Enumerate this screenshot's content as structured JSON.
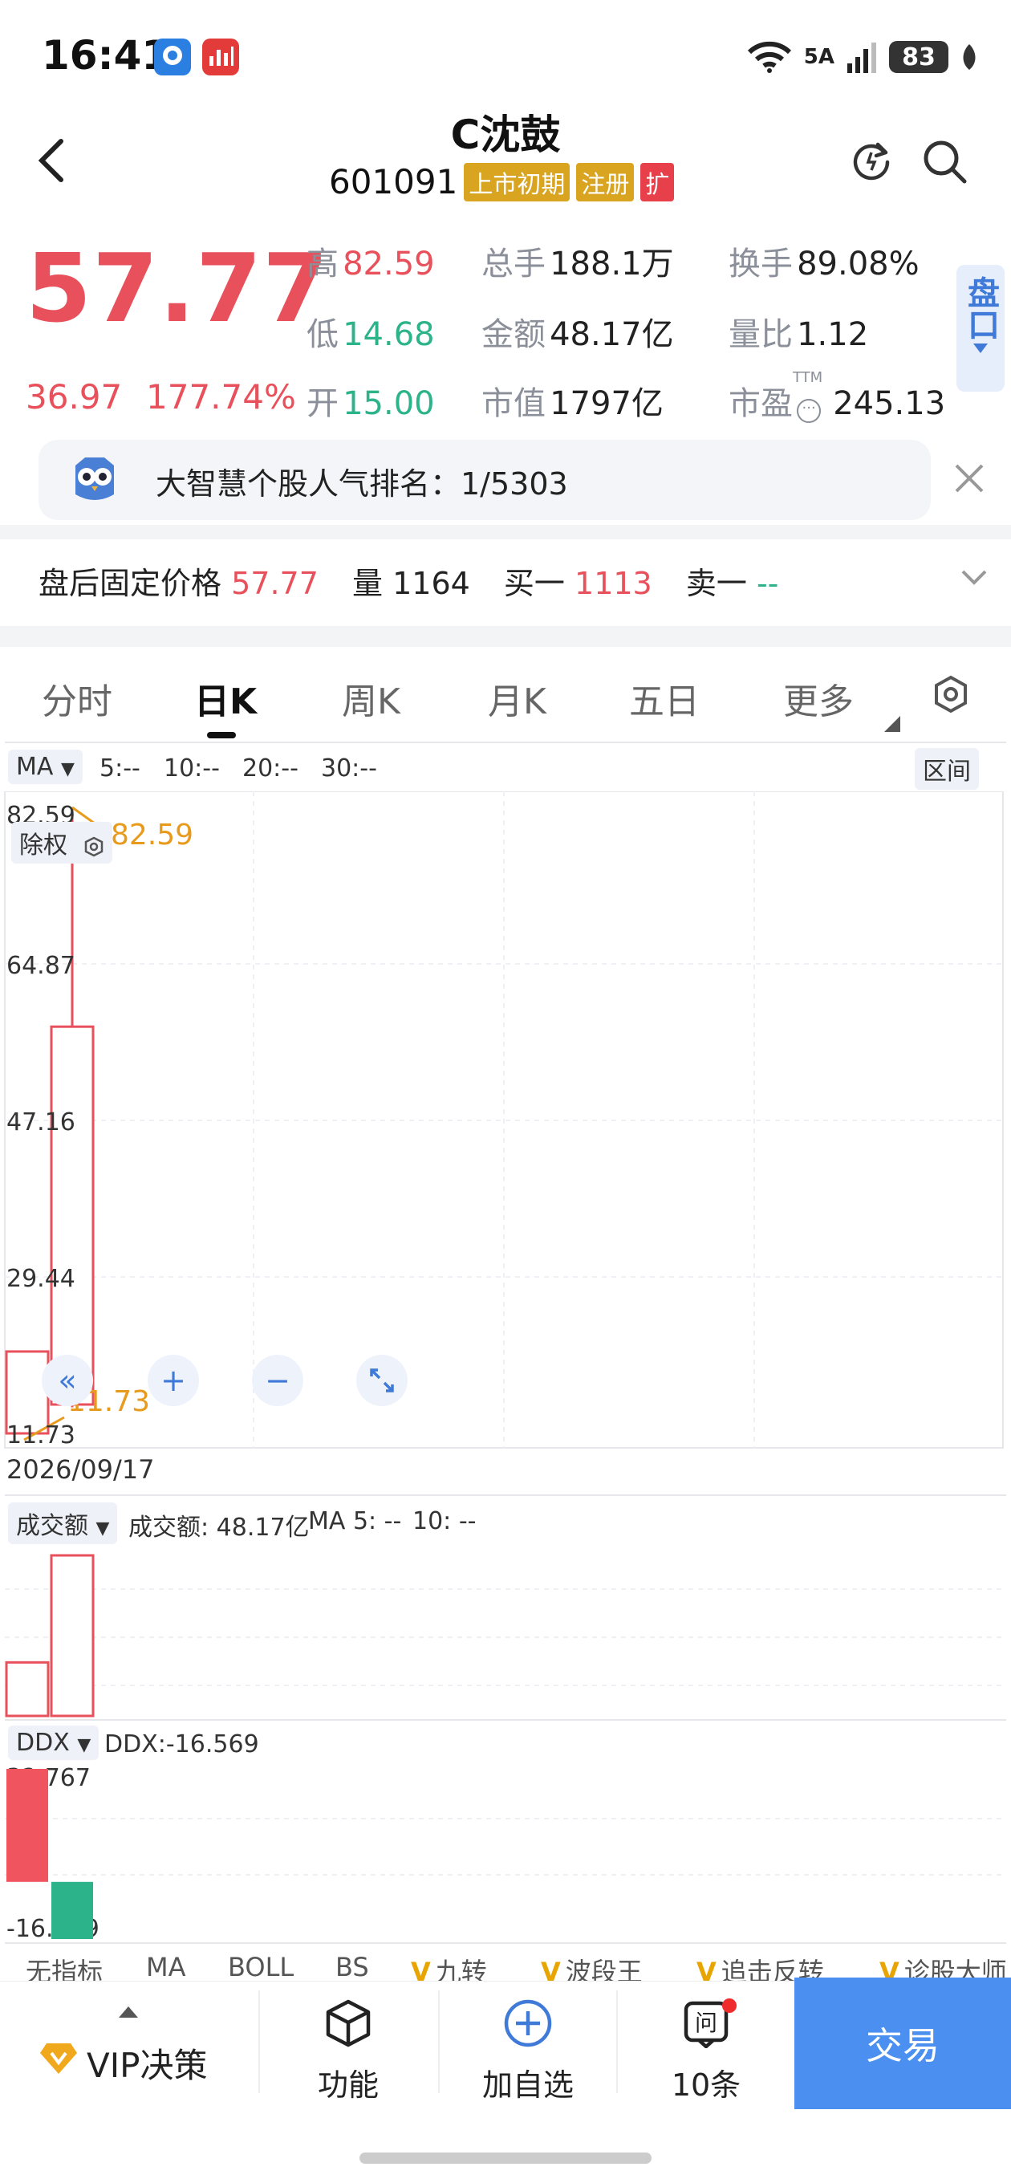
{
  "status_bar": {
    "time": "16:41",
    "network": "5A",
    "battery": "83",
    "icons": [
      "wifi-icon",
      "signal-icon",
      "battery-icon",
      "leaf-icon"
    ]
  },
  "header": {
    "title": "C沈鼓",
    "code": "601091",
    "tags": [
      {
        "label": "上市初期",
        "color": "#d9a521"
      },
      {
        "label": "注册",
        "color": "#d9a521"
      },
      {
        "label": "扩",
        "color": "#e8404b"
      }
    ]
  },
  "quote": {
    "price": "57.77",
    "change": "36.97",
    "change_pct": "177.74%",
    "fields": [
      {
        "label": "高",
        "value": "82.59",
        "color": "red"
      },
      {
        "label": "低",
        "value": "14.68",
        "color": "green"
      },
      {
        "label": "开",
        "value": "15.00",
        "color": "green"
      },
      {
        "label": "总手",
        "value": "188.1万",
        "color": "black"
      },
      {
        "label": "金额",
        "value": "48.17亿",
        "color": "black"
      },
      {
        "label": "市值",
        "value": "1797亿",
        "color": "black"
      },
      {
        "label": "换手",
        "value": "89.08%",
        "color": "black"
      },
      {
        "label": "量比",
        "value": "1.12",
        "color": "black"
      },
      {
        "label": "市盈",
        "value": "245.13",
        "color": "black"
      }
    ],
    "pe_tag": "TTM",
    "side_tab": "盘口"
  },
  "notice": {
    "text": "大智慧个股人气排名：1/5303"
  },
  "after_hours": {
    "label": "盘后固定价格",
    "price": "57.77",
    "vol_label": "量",
    "vol": "1164",
    "buy_label": "买一",
    "buy": "1113",
    "sell_label": "卖一",
    "sell": "--"
  },
  "tabs": [
    "分时",
    "日K",
    "周K",
    "月K",
    "五日",
    "更多"
  ],
  "active_tab": "日K",
  "ma_bar": {
    "label": "MA",
    "ma5": "5:--",
    "ma10": "10:--",
    "ma20": "20:--",
    "ma30": "30:--",
    "range_button": "区间"
  },
  "kline": {
    "y_ticks": [
      "82.59",
      "64.87",
      "47.16",
      "29.44",
      "11.73"
    ],
    "ex_rights": "除权",
    "high_label": "82.59",
    "low_label": "11.73",
    "date": "2026/09/17",
    "candles": [
      {
        "open": 11.73,
        "close": 21.0,
        "high": 21.0,
        "low": 11.73
      },
      {
        "open": 15.0,
        "close": 57.77,
        "high": 82.59,
        "low": 14.68
      }
    ],
    "y_range": [
      11.73,
      82.59
    ]
  },
  "volume": {
    "label": "成交额",
    "text": "成交额: 48.17亿",
    "ma5": "MA 5: --",
    "ma10": "10: --",
    "bars": [
      12,
      36
    ]
  },
  "ddx": {
    "label": "DDX",
    "text": "DDX:-16.569",
    "max": "32.767",
    "min": "-16.569",
    "bars": [
      32.767,
      -16.569
    ]
  },
  "indicators": [
    {
      "label": "无指标",
      "vip": false,
      "active": false
    },
    {
      "label": "MA",
      "vip": false,
      "active": true
    },
    {
      "label": "BOLL",
      "vip": false,
      "active": false
    },
    {
      "label": "BS",
      "vip": false,
      "active": false
    },
    {
      "label": "九转",
      "vip": true,
      "active": false
    },
    {
      "label": "波段王",
      "vip": true,
      "active": false
    },
    {
      "label": "追击反转",
      "vip": true,
      "active": false
    },
    {
      "label": "诊股大师",
      "vip": true,
      "active": false
    }
  ],
  "bottom_bar": {
    "vip": "VIP决策",
    "func": "功能",
    "add": "加自选",
    "ask": "10条",
    "trade": "交易"
  }
}
